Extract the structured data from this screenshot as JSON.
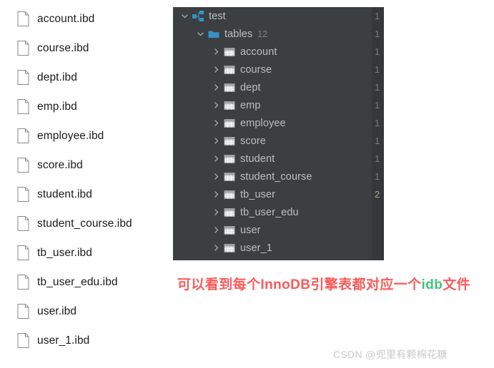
{
  "file_list": {
    "icon": "file-document-icon",
    "files": [
      {
        "name": "account.ibd"
      },
      {
        "name": "course.ibd"
      },
      {
        "name": "dept.ibd"
      },
      {
        "name": "emp.ibd"
      },
      {
        "name": "employee.ibd"
      },
      {
        "name": "score.ibd"
      },
      {
        "name": "student.ibd"
      },
      {
        "name": "student_course.ibd"
      },
      {
        "name": "tb_user.ibd"
      },
      {
        "name": "tb_user_edu.ibd"
      },
      {
        "name": "user.ibd"
      },
      {
        "name": "user_1.ibd"
      }
    ]
  },
  "tree_panel": {
    "background": "#3c3f41",
    "gutter_background": "#35383a",
    "accent": "#3592c4",
    "label_color": "#bdbdbd",
    "rows": [
      {
        "label": "test",
        "icon": "schema-icon",
        "twisty": "chevron-down",
        "indent": 0,
        "count": "",
        "gutter": "1",
        "gutter_highlight": false
      },
      {
        "label": "tables",
        "icon": "folder-icon",
        "twisty": "chevron-down",
        "indent": 1,
        "count": "12",
        "gutter": "1",
        "gutter_highlight": false
      },
      {
        "label": "account",
        "icon": "table-icon",
        "twisty": "chevron-right",
        "indent": 2,
        "count": "",
        "gutter": "1",
        "gutter_highlight": false
      },
      {
        "label": "course",
        "icon": "table-icon",
        "twisty": "chevron-right",
        "indent": 2,
        "count": "",
        "gutter": "1",
        "gutter_highlight": false
      },
      {
        "label": "dept",
        "icon": "table-icon",
        "twisty": "chevron-right",
        "indent": 2,
        "count": "",
        "gutter": "1",
        "gutter_highlight": false
      },
      {
        "label": "emp",
        "icon": "table-icon",
        "twisty": "chevron-right",
        "indent": 2,
        "count": "",
        "gutter": "1",
        "gutter_highlight": false
      },
      {
        "label": "employee",
        "icon": "table-icon",
        "twisty": "chevron-right",
        "indent": 2,
        "count": "",
        "gutter": "1",
        "gutter_highlight": false
      },
      {
        "label": "score",
        "icon": "table-icon",
        "twisty": "chevron-right",
        "indent": 2,
        "count": "",
        "gutter": "1",
        "gutter_highlight": false
      },
      {
        "label": "student",
        "icon": "table-icon",
        "twisty": "chevron-right",
        "indent": 2,
        "count": "",
        "gutter": "1",
        "gutter_highlight": false
      },
      {
        "label": "student_course",
        "icon": "table-icon",
        "twisty": "chevron-right",
        "indent": 2,
        "count": "",
        "gutter": "1",
        "gutter_highlight": false
      },
      {
        "label": "tb_user",
        "icon": "table-icon",
        "twisty": "chevron-right",
        "indent": 2,
        "count": "",
        "gutter": "2",
        "gutter_highlight": true
      },
      {
        "label": "tb_user_edu",
        "icon": "table-icon",
        "twisty": "chevron-right",
        "indent": 2,
        "count": "",
        "gutter": "",
        "gutter_highlight": false
      },
      {
        "label": "user",
        "icon": "table-icon",
        "twisty": "chevron-right",
        "indent": 2,
        "count": "",
        "gutter": "",
        "gutter_highlight": false
      },
      {
        "label": "user_1",
        "icon": "table-icon",
        "twisty": "chevron-right",
        "indent": 2,
        "count": "",
        "gutter": "",
        "gutter_highlight": false
      }
    ]
  },
  "annotation": {
    "part1": "可以看到每个InnoDB引擎表都对应一个",
    "part2": "idb",
    "part3": "文件",
    "color_red": "#fa5a5a",
    "color_green": "#3fc47a"
  },
  "watermark": {
    "text": "CSDN @兜里有颗棉花糖"
  }
}
